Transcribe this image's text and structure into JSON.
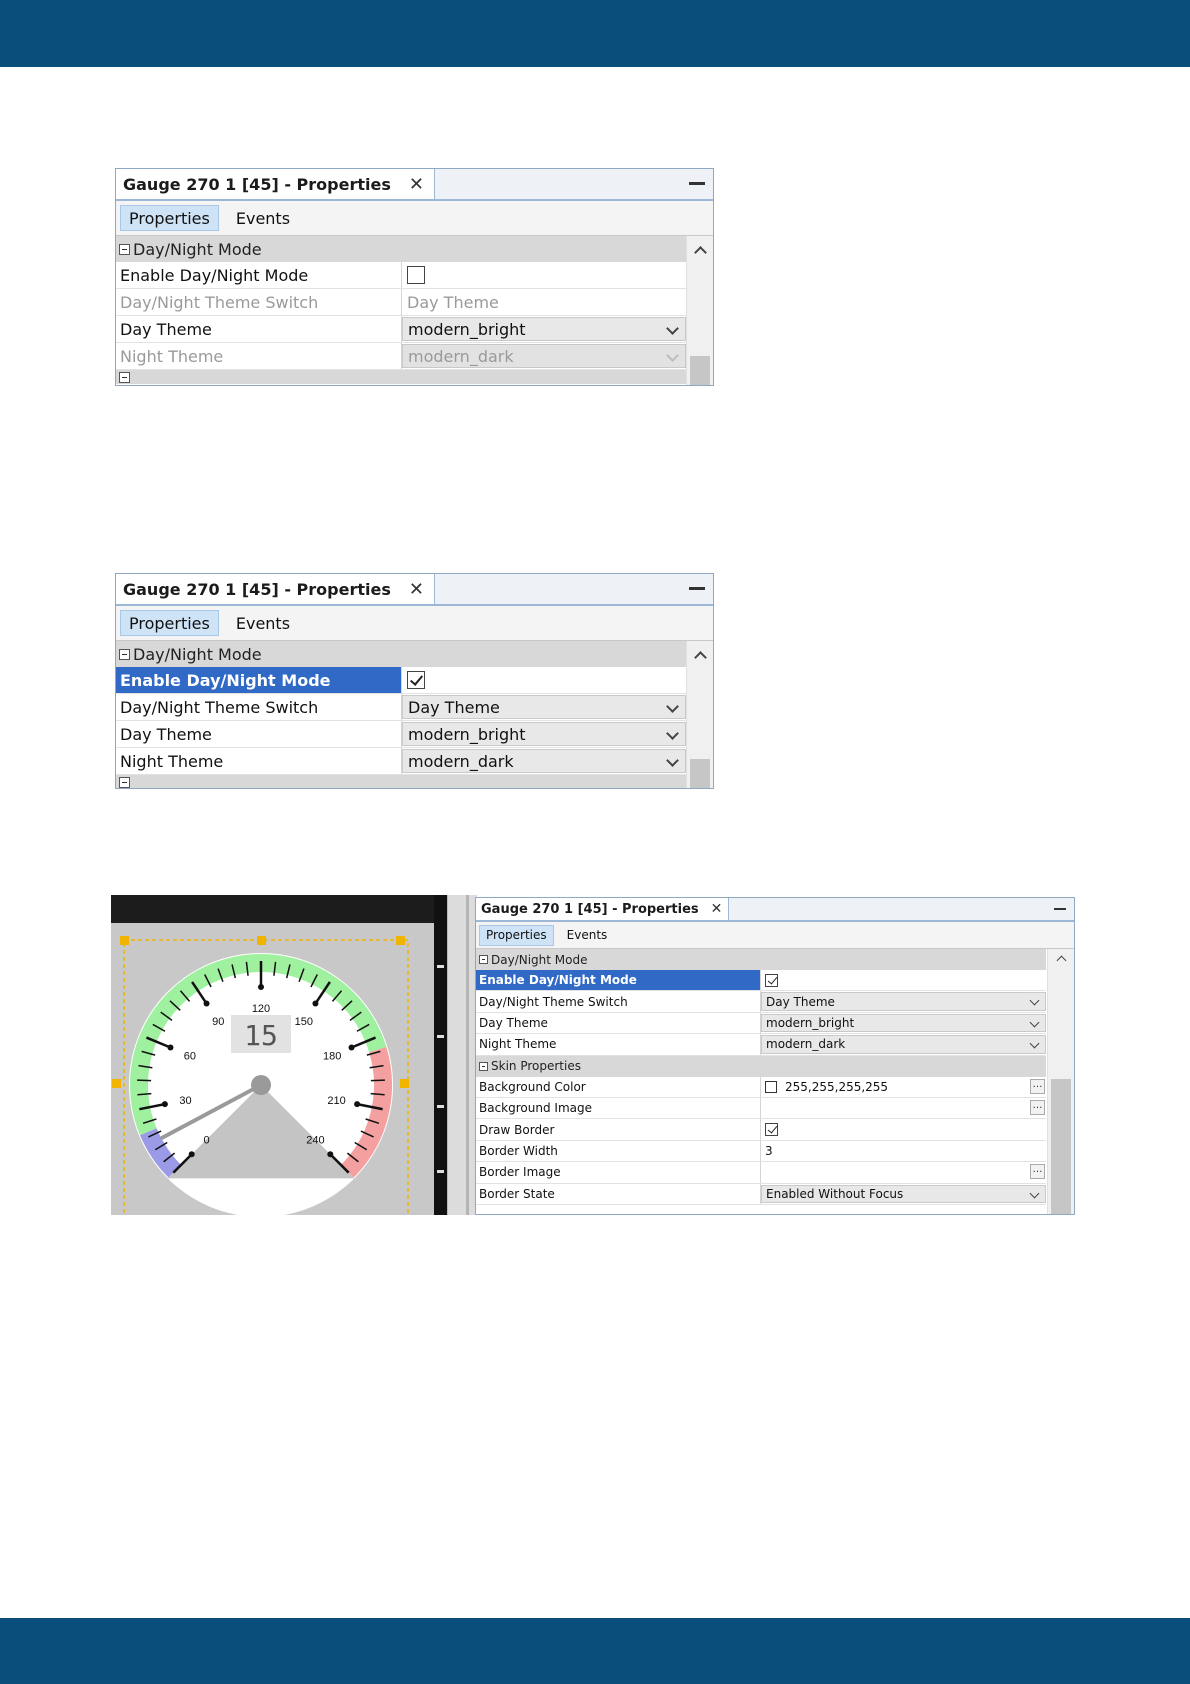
{
  "panel_top": {
    "title": "Gauge 270 1 [45] - Properties",
    "tabs": [
      "Properties",
      "Events"
    ],
    "category": "Day/Night Mode",
    "rows": [
      {
        "name": "Enable Day/Night Mode",
        "value": "",
        "checked": false
      },
      {
        "name": "Day/Night Theme Switch",
        "value": "Day Theme"
      },
      {
        "name": "Day Theme",
        "value": "modern_bright"
      },
      {
        "name": "Night Theme",
        "value": "modern_dark"
      }
    ]
  },
  "panel_middle": {
    "title": "Gauge 270 1 [45] - Properties",
    "tabs": [
      "Properties",
      "Events"
    ],
    "category": "Day/Night Mode",
    "rows": [
      {
        "name": "Enable Day/Night Mode",
        "value": "",
        "checked": true
      },
      {
        "name": "Day/Night Theme Switch",
        "value": "Day Theme"
      },
      {
        "name": "Day Theme",
        "value": "modern_bright"
      },
      {
        "name": "Night Theme",
        "value": "modern_dark"
      }
    ]
  },
  "gauge": {
    "display_value": "15",
    "tick_labels": [
      "0",
      "30",
      "60",
      "90",
      "120",
      "150",
      "180",
      "210",
      "240"
    ],
    "needle_value": 15,
    "colors": {
      "low": "#9a9ae6",
      "mid": "#9ff09f",
      "high": "#f4a0a0",
      "face": "#ffffff",
      "selection": "#f0b400"
    }
  },
  "panel_bottom": {
    "title": "Gauge 270 1 [45] - Properties",
    "tabs": [
      "Properties",
      "Events"
    ],
    "category1": "Day/Night Mode",
    "rows1": [
      {
        "name": "Enable Day/Night Mode",
        "value": "",
        "checked": true
      },
      {
        "name": "Day/Night Theme Switch",
        "value": "Day Theme"
      },
      {
        "name": "Day Theme",
        "value": "modern_bright"
      },
      {
        "name": "Night Theme",
        "value": "modern_dark"
      }
    ],
    "category2": "Skin Properties",
    "rows2": [
      {
        "name": "Background Color",
        "value": "255,255,255,255"
      },
      {
        "name": "Background Image",
        "value": ""
      },
      {
        "name": "Draw Border",
        "value": "",
        "checked": true
      },
      {
        "name": "Border Width",
        "value": "3"
      },
      {
        "name": "Border Image",
        "value": ""
      },
      {
        "name": "Border State",
        "value": "Enabled Without Focus"
      }
    ]
  },
  "colors": {
    "brand_band": "#0a4f7c",
    "selection": "#3169c6"
  }
}
